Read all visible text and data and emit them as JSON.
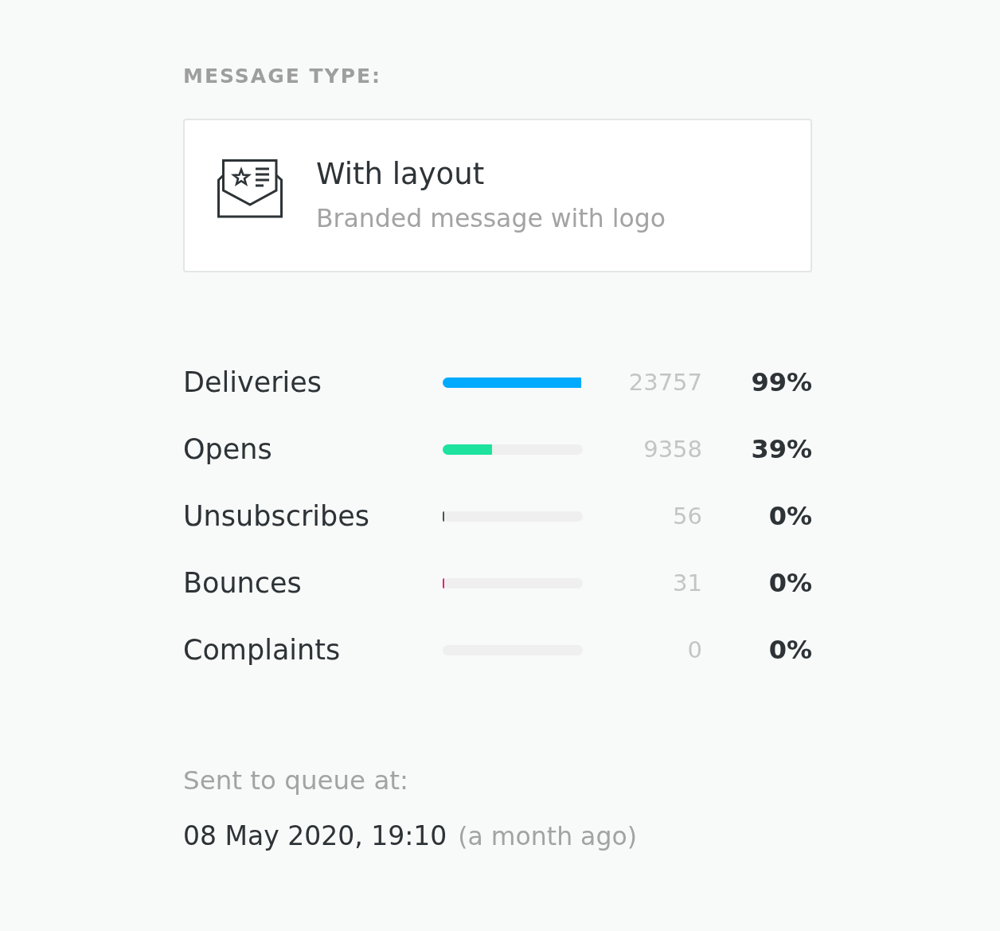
{
  "message_type": {
    "heading": "MESSAGE TYPE:",
    "card": {
      "title": "With layout",
      "subtitle": "Branded message with logo"
    }
  },
  "stats": [
    {
      "label": "Deliveries",
      "level": 0.99,
      "color": "#00aaff",
      "count": "23757",
      "percent": "99%"
    },
    {
      "label": "Opens",
      "level": 0.35,
      "color": "#1de39e",
      "count": "9358",
      "percent": "39%"
    },
    {
      "label": "Unsubscribes",
      "level": 0.012,
      "color": "#4b5258",
      "count": "56",
      "percent": "0%"
    },
    {
      "label": "Bounces",
      "level": 0.012,
      "color": "#ea1e78",
      "count": "31",
      "percent": "0%"
    },
    {
      "label": "Complaints",
      "count": "0",
      "percent": "0%"
    }
  ],
  "queue": {
    "label": "Sent to queue at:",
    "date": "08 May 2020, 19:10",
    "relative": "(a month ago)"
  }
}
